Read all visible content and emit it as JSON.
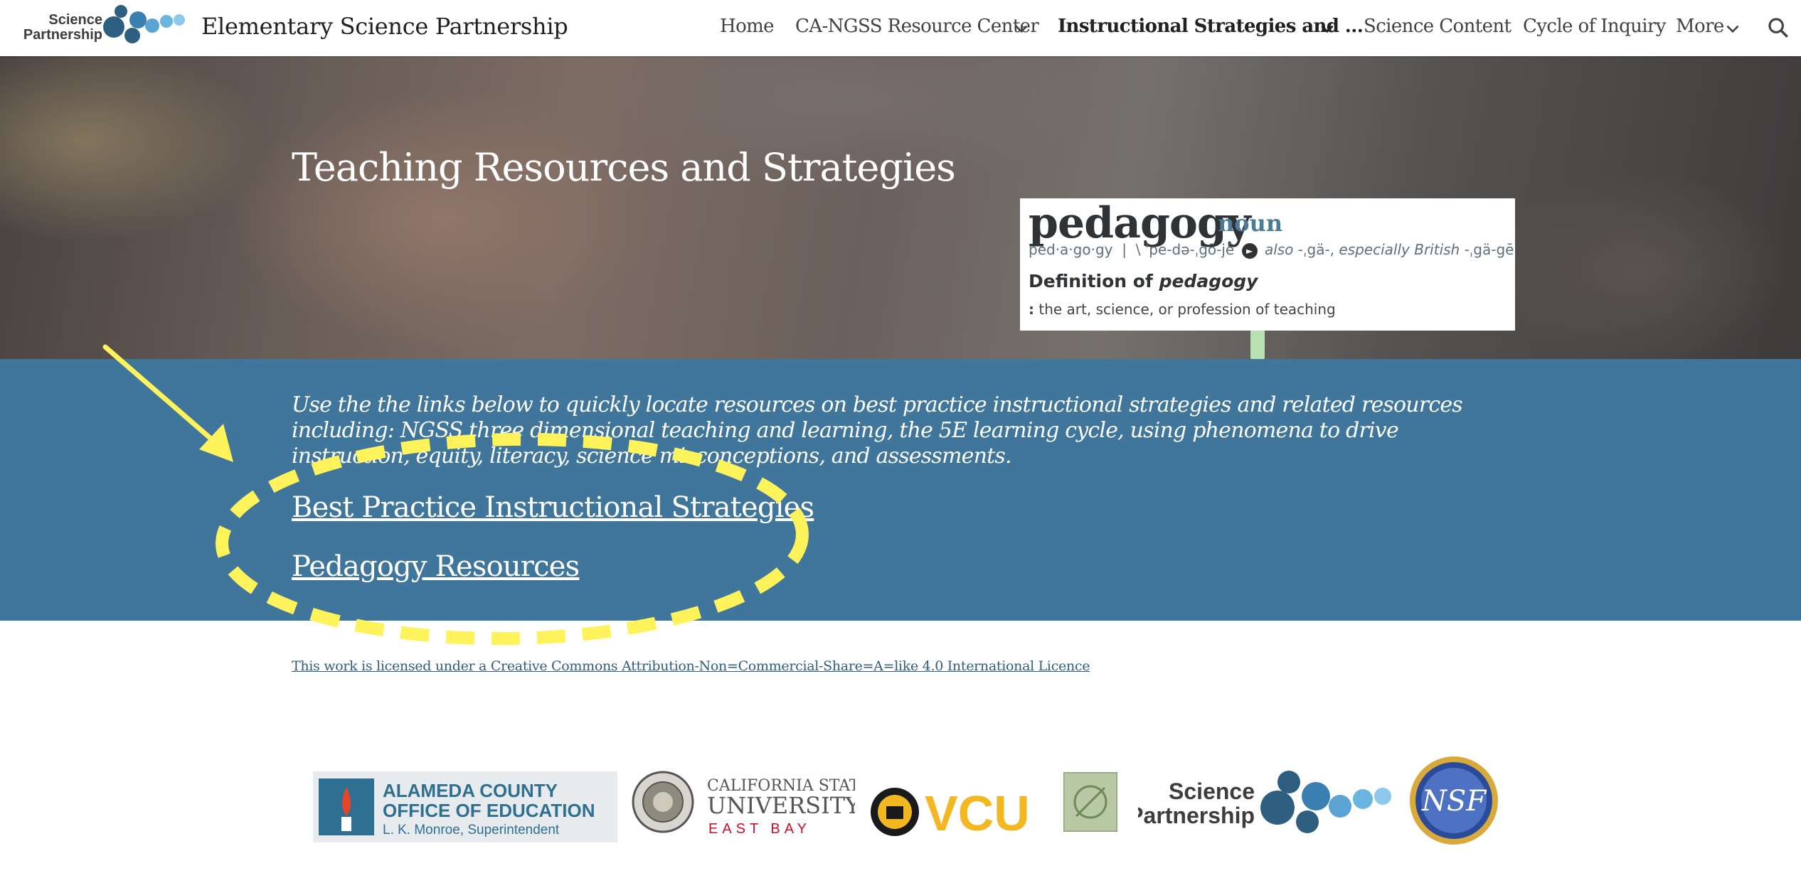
{
  "header": {
    "logo_text": [
      "Science",
      "Partnership"
    ],
    "site_title": "Elementary Science Partnership",
    "nav": [
      {
        "label": "Home",
        "has_dropdown": false,
        "active": false
      },
      {
        "label": "CA-NGSS Resource Center",
        "has_dropdown": true,
        "active": false
      },
      {
        "label": "Instructional Strategies and ...",
        "has_dropdown": true,
        "active": true
      },
      {
        "label": "Science Content",
        "has_dropdown": false,
        "active": false
      },
      {
        "label": "Cycle of Inquiry",
        "has_dropdown": false,
        "active": false
      },
      {
        "label": "More",
        "has_dropdown": true,
        "active": false
      }
    ],
    "search_icon": "search-icon"
  },
  "hero": {
    "title": "Teaching Resources and Strategies",
    "definition_card": {
      "word": "pedagogy",
      "part_of_speech": "noun",
      "pron_syllables": "ped·a·go·gy",
      "pron_sep": "|",
      "pron_main": "\\ ˈpe-də-ˌgō-jē",
      "pron_also_label": "also",
      "pron_also": "-ˌgä-,",
      "pron_brit_label": "especially British",
      "pron_brit": "-ˌgä-gē",
      "pron_end": "\\",
      "definition_heading": "Definition of",
      "definition_word": "pedagogy",
      "definition_marker": ":",
      "definition_text": "the art, science, or profession of teaching"
    }
  },
  "intro": {
    "text": "Use the the links below to quickly locate resources on best practice instructional strategies and related resources including: NGSS three dimensional teaching and learning, the 5E learning cycle, using phenomena to drive instruction, equity, literacy, science misconceptions, and assessments."
  },
  "links": [
    {
      "label": "Best Practice Instructional Strategies"
    },
    {
      "label": "Pedagogy Resources"
    }
  ],
  "annotation": {
    "color": "#fff35c"
  },
  "footer": {
    "license": "This work is licensed under a Creative Commons Attribution-Non=Commercial-Share=A=like 4.0 International Licence",
    "logos": {
      "alameda": [
        "ALAMEDA COUNTY",
        "OFFICE OF EDUCATION",
        "L. K. Monroe, Superintendent"
      ],
      "csu": [
        "CALIFORNIA STATE",
        "UNIVERSITY",
        "EAST BAY"
      ],
      "vcu": "VCU",
      "science_partnership": [
        "Science",
        "Partnership"
      ],
      "nsf": "NSF"
    }
  },
  "colors": {
    "band": "#40769b",
    "link_text": "#ffffff",
    "csu_red": "#c8102e",
    "vcu_gold": "#f3b722"
  }
}
